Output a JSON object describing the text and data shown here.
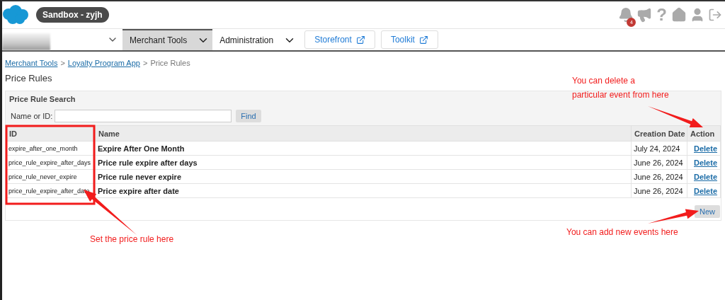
{
  "header": {
    "environment": "Sandbox - zyjh",
    "notification_count": "4",
    "help_glyph": "?"
  },
  "nav": {
    "menus": [
      {
        "label": "Merchant Tools",
        "selected": true
      },
      {
        "label": "Administration",
        "selected": false
      }
    ],
    "links": [
      "Storefront",
      "Toolkit"
    ]
  },
  "breadcrumb": {
    "separator": ">",
    "items": [
      {
        "label": "Merchant Tools",
        "link": true
      },
      {
        "label": "Loyalty Program App",
        "link": true
      },
      {
        "label": "Price Rules",
        "link": false
      }
    ]
  },
  "page_title": "Price Rules",
  "search": {
    "title": "Price Rule Search",
    "label": "Name or ID:",
    "button": "Find"
  },
  "table": {
    "columns": [
      "ID",
      "Name",
      "Creation Date",
      "Action"
    ],
    "rows": [
      {
        "id": "expire_after_one_month",
        "name": "Expire After One Month",
        "date": "July 24, 2024",
        "action": "Delete"
      },
      {
        "id": "price_rule_expire_after_days",
        "name": "Price rule expire after days",
        "date": "June 26, 2024",
        "action": "Delete"
      },
      {
        "id": "price_rule_never_expire",
        "name": "Price rule never expire",
        "date": "June 26, 2024",
        "action": "Delete"
      },
      {
        "id": "price_rule_expire_after_date",
        "name": "Price expire after date",
        "date": "June 26, 2024",
        "action": "Delete"
      }
    ]
  },
  "new_button": "New",
  "annotations": [
    {
      "kind": "delete",
      "text": "You can delete a particular event from here"
    },
    {
      "kind": "id",
      "text": "Set the price rule here"
    },
    {
      "kind": "new",
      "text": "You can add new events here"
    }
  ]
}
